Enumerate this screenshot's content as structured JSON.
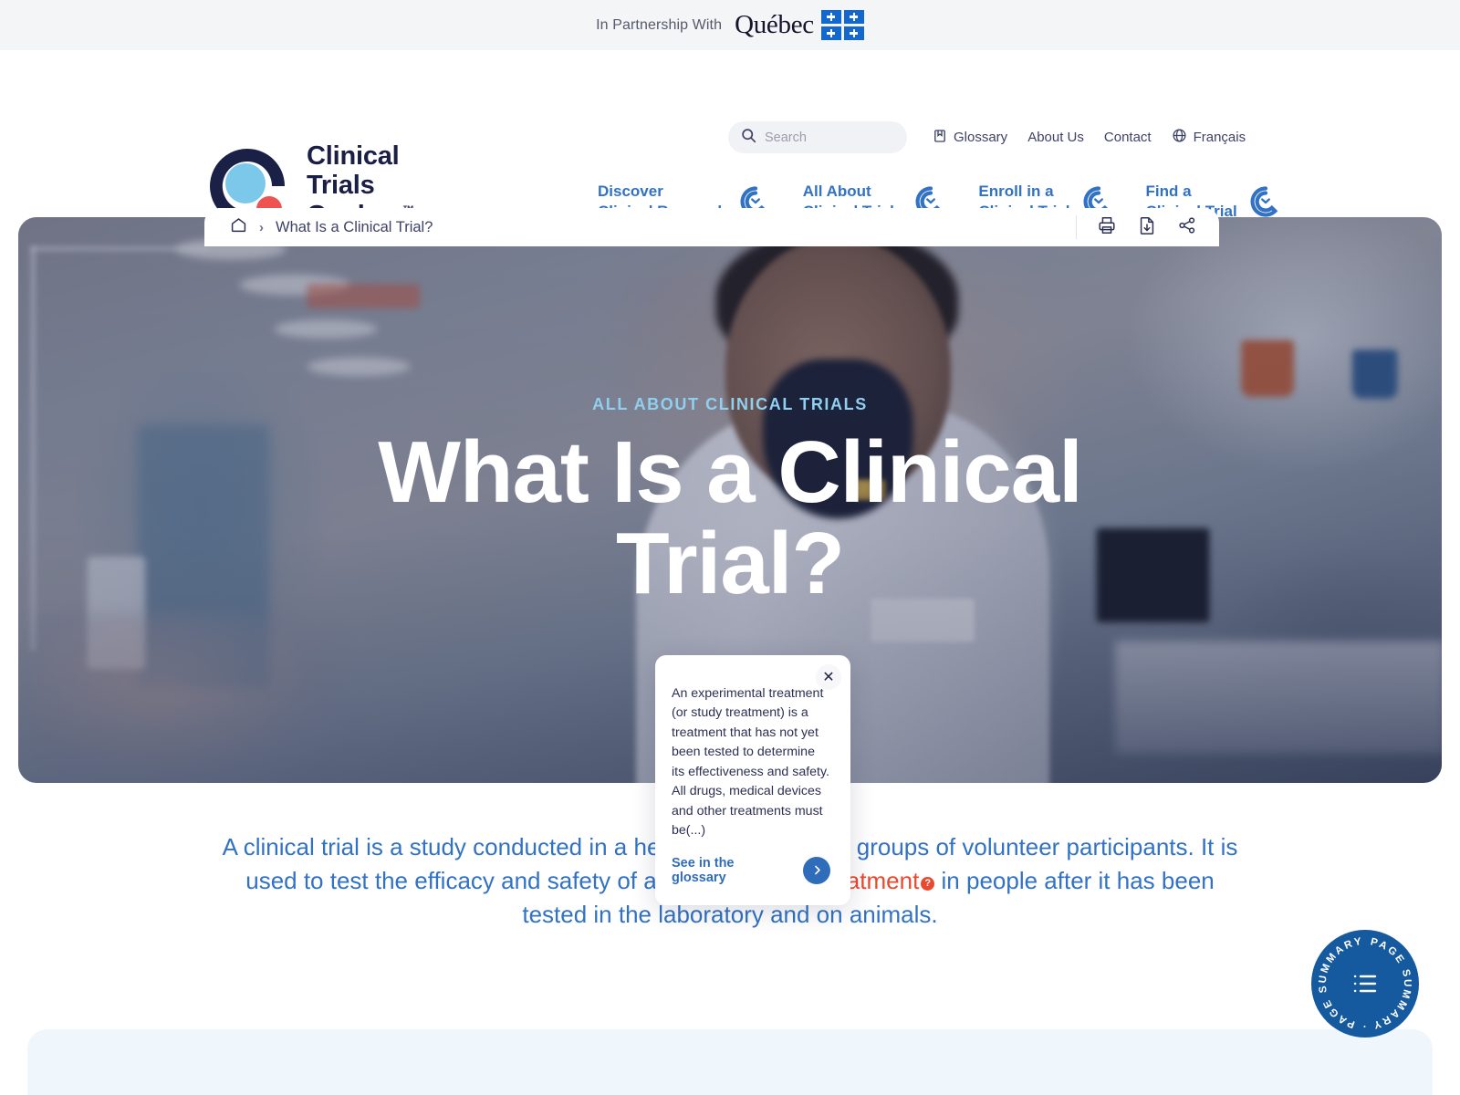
{
  "partnership": {
    "label": "In Partnership With",
    "brand": "Québec",
    "flag_icon": "quebec-flag-icon"
  },
  "brand": {
    "name_line1": "Clinical",
    "name_line2": "Trials",
    "name_line3": "Quebec",
    "trademark": "™",
    "logo_icon": "clinical-trials-quebec-logo",
    "colors": {
      "navy": "#1b1f46",
      "light_blue": "#7cc8ea",
      "coral": "#ef5350",
      "primary_blue": "#3272c4",
      "link_blue": "#2f6cba",
      "accent_red": "#e8492f",
      "eyebrow_blue": "#8fd0f0"
    }
  },
  "search": {
    "placeholder": "Search",
    "value": "",
    "icon": "search-icon"
  },
  "utility_nav": [
    {
      "label": "Glossary",
      "icon": "book-icon"
    },
    {
      "label": "About Us",
      "icon": ""
    },
    {
      "label": "Contact",
      "icon": ""
    },
    {
      "label": "Français",
      "icon": "globe-icon"
    }
  ],
  "main_nav": [
    {
      "line1": "Discover",
      "line2": "Clinical Research",
      "icon": "chevron-down-circle-icon"
    },
    {
      "line1": "All About",
      "line2": "Clinical Trials",
      "icon": "chevron-down-circle-icon"
    },
    {
      "line1": "Enroll in a",
      "line2": "Clinical Trial",
      "icon": "chevron-down-circle-icon"
    },
    {
      "line1": "Find a",
      "line2": "Clinical Trial",
      "icon": "chevron-down-circle-icon"
    }
  ],
  "breadcrumb": {
    "home_icon": "home-icon",
    "separator": "›",
    "current": "What Is a Clinical Trial?",
    "actions": [
      {
        "icon": "print-icon"
      },
      {
        "icon": "download-icon"
      },
      {
        "icon": "share-icon"
      }
    ]
  },
  "hero": {
    "eyebrow": "ALL ABOUT CLINICAL TRIALS",
    "title": "What Is a Clinical Trial?"
  },
  "tooltip": {
    "close_icon": "close-icon",
    "body": "An experimental treatment (or study treatment) is a treatment that has not yet been tested to determine its effectiveness and safety. All drugs, medical devices and other treatments must be(...)",
    "cta_label": "See in the glossary",
    "cta_icon": "chevron-right-icon"
  },
  "intro": {
    "part1": "A clinical trial is a study conducted in a healthcare facility on groups of volunteer participants. It is used to test the efficacy and safety of an ",
    "term": "experimental treatment",
    "term_badge": "?",
    "part2": " in people after it has been tested in the laboratory and on animals."
  },
  "summary_badge": {
    "ring_text": "PAGE SUMMARY · PAGE SUMMARY · ",
    "icon": "list-icon",
    "color": "#15599f"
  }
}
